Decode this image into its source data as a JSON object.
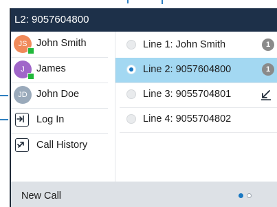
{
  "titlebar": {
    "title": "L2: 9057604800"
  },
  "sidebar": {
    "contacts": [
      {
        "initials": "JS",
        "name": "John Smith",
        "avatar_color": "#f08a5a",
        "present": true
      },
      {
        "initials": "J",
        "name": "James",
        "avatar_color": "#a066c9",
        "present": true
      },
      {
        "initials": "JD",
        "name": "John Doe",
        "avatar_color": "#9aaabb",
        "present": false
      }
    ],
    "actions": [
      {
        "label": "Log In",
        "icon": "login-icon"
      },
      {
        "label": "Call History",
        "icon": "call-history-icon"
      }
    ]
  },
  "lines": [
    {
      "label": "Line 1: John Smith",
      "selected": false,
      "badge": "1",
      "indicator": "badge"
    },
    {
      "label": "Line 2: 9057604800",
      "selected": true,
      "badge": "1",
      "indicator": "badge"
    },
    {
      "label": "Line 3: 9055704801",
      "selected": false,
      "indicator": "missed-call-arrow-icon"
    },
    {
      "label": "Line 4: 9055704802",
      "selected": false,
      "indicator": "none"
    }
  ],
  "softkeys": {
    "new_call": "New Call"
  },
  "pagination": {
    "pages": 2,
    "current": 1
  },
  "colors": {
    "titlebar": "#1d3049",
    "selected_row": "#a3d8f2",
    "presence": "#21b83b",
    "accent": "#1a78c2",
    "bottombar": "#dde1e6"
  }
}
